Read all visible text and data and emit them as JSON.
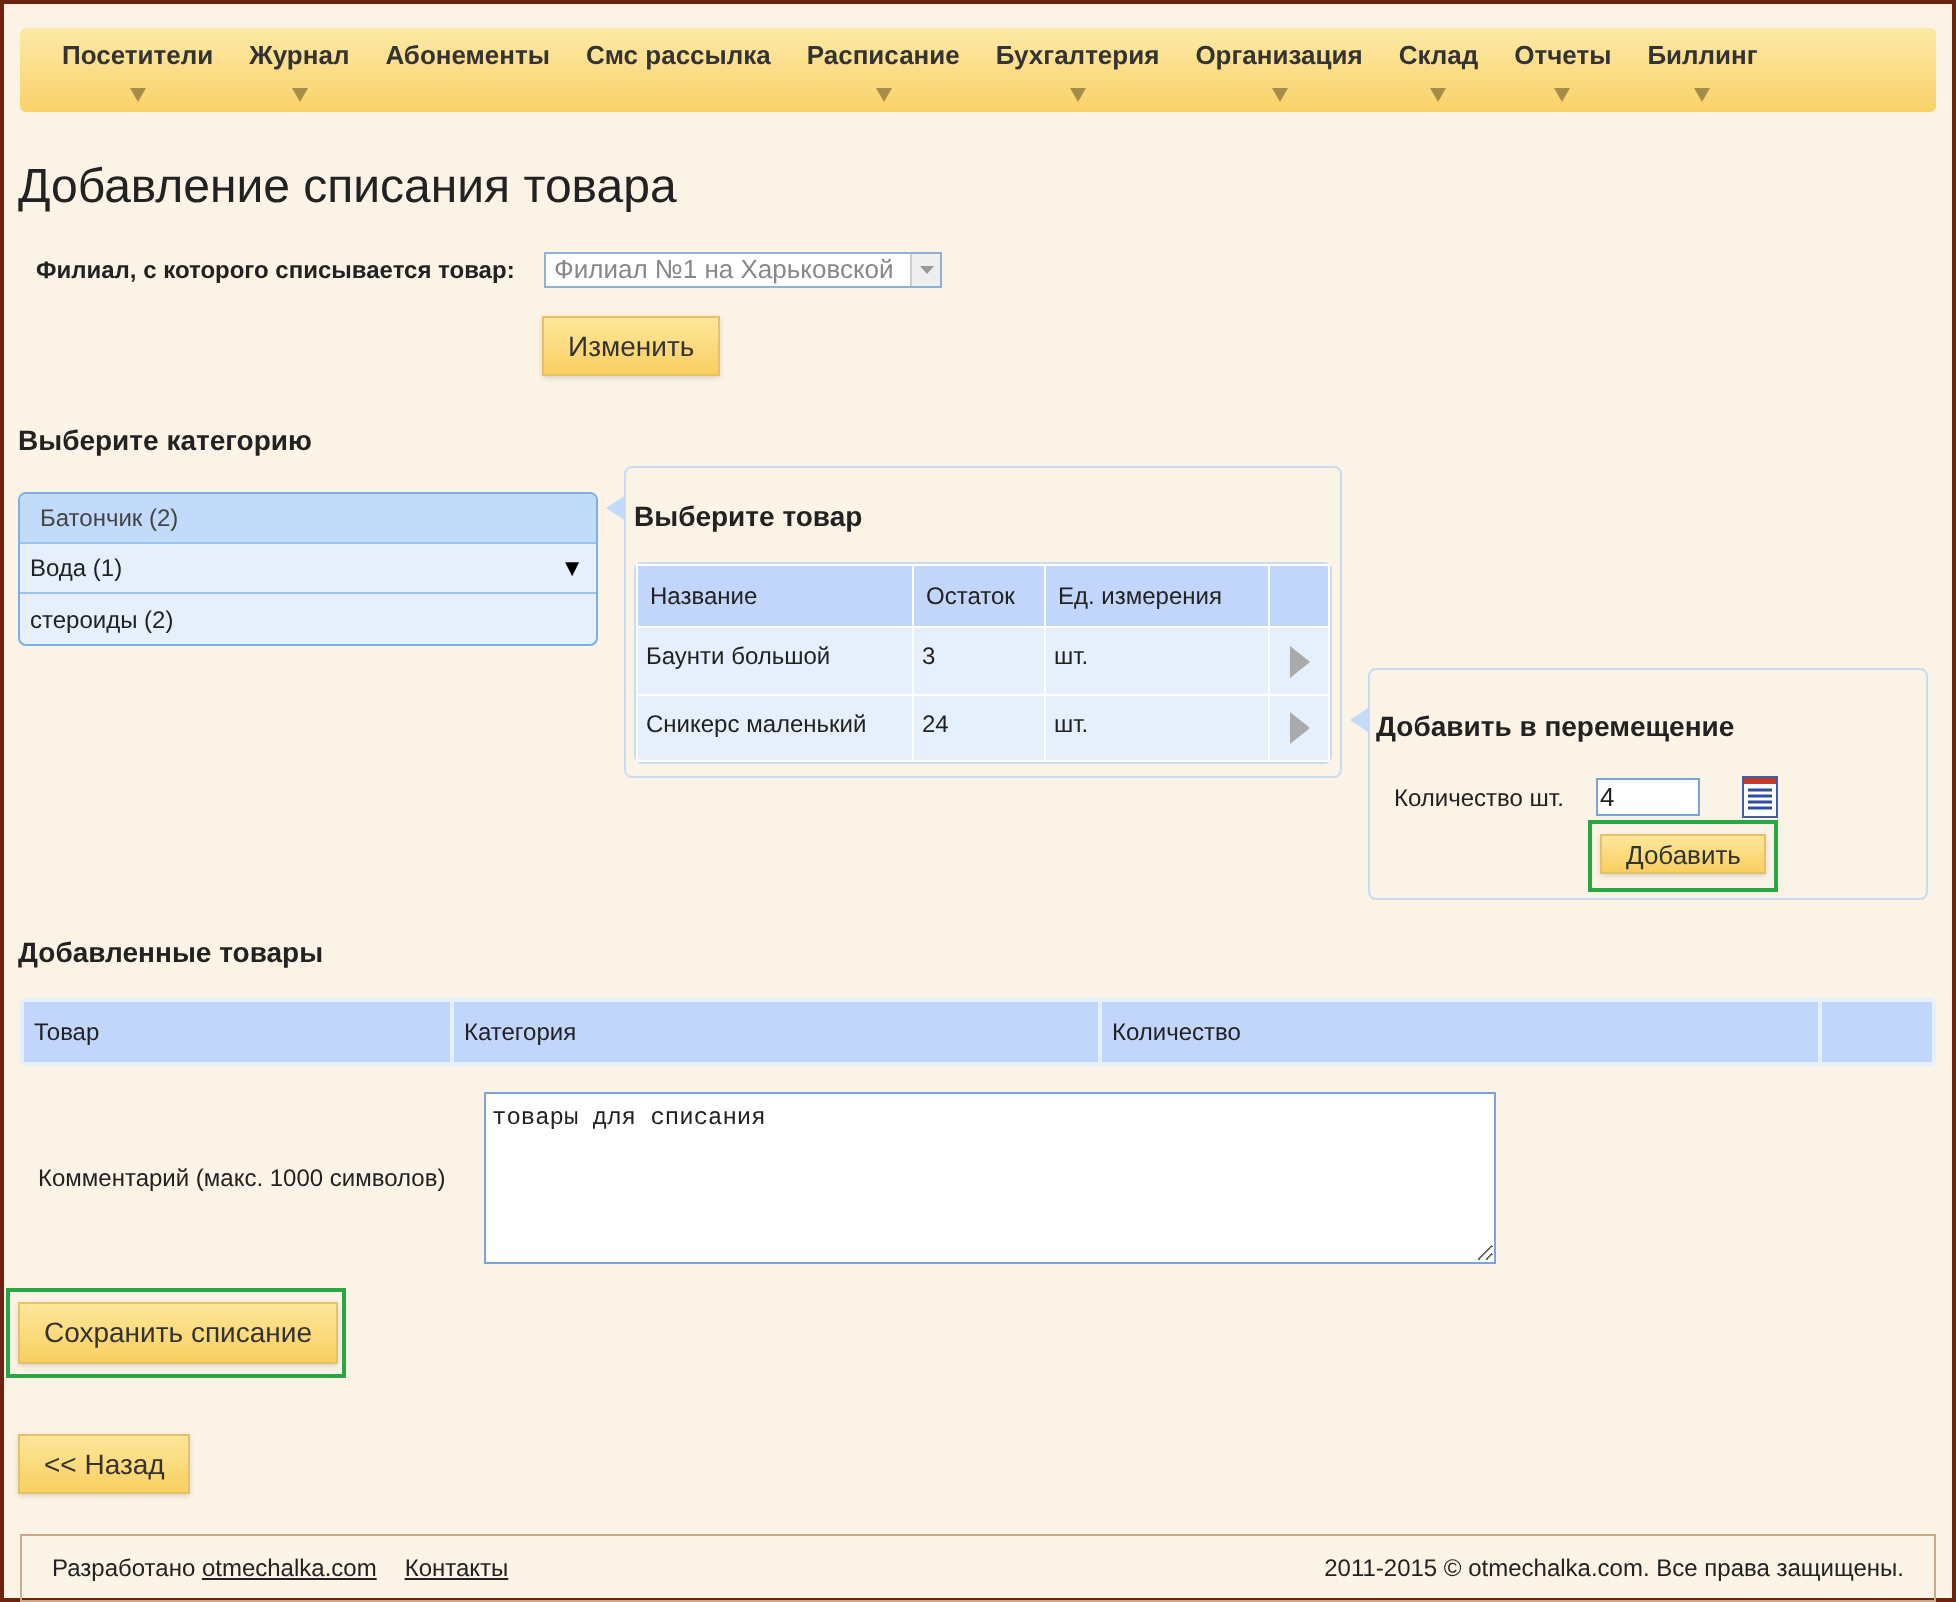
{
  "nav": [
    {
      "label": "Посетители",
      "has_menu": true
    },
    {
      "label": "Журнал",
      "has_menu": true
    },
    {
      "label": "Абонементы",
      "has_menu": false
    },
    {
      "label": "Смс рассылка",
      "has_menu": false
    },
    {
      "label": "Расписание",
      "has_menu": true
    },
    {
      "label": "Бухгалтерия",
      "has_menu": true
    },
    {
      "label": "Организация",
      "has_menu": true
    },
    {
      "label": "Склад",
      "has_menu": true
    },
    {
      "label": "Отчеты",
      "has_menu": true
    },
    {
      "label": "Биллинг",
      "has_menu": true
    }
  ],
  "title": "Добавление списания товара",
  "branch": {
    "label": "Филиал, с которого списывается товар:",
    "value": "Филиал №1 на Харьковской",
    "button": "Изменить"
  },
  "categories": {
    "heading": "Выберите категорию",
    "items": [
      {
        "label": "Батончик (2)",
        "selected": true
      },
      {
        "label": "Вода (1)",
        "selected": false,
        "expandable": true,
        "expander": "▼"
      },
      {
        "label": "стероиды (2)",
        "selected": false
      }
    ]
  },
  "products": {
    "heading": "Выберите товар",
    "columns": [
      "Название",
      "Остаток",
      "Ед. измерения"
    ],
    "rows": [
      {
        "name": "Баунти большой",
        "stock": "3",
        "unit": "шт."
      },
      {
        "name": "Сникерс маленький",
        "stock": "24",
        "unit": "шт."
      }
    ]
  },
  "add_panel": {
    "heading": "Добавить в перемещение",
    "quantity_label": "Количество шт.",
    "quantity": "4",
    "button": "Добавить",
    "highlighted": true
  },
  "added": {
    "heading": "Добавленные товары",
    "columns": [
      "Товар",
      "Категория",
      "Количество"
    ]
  },
  "comment": {
    "label": "Комментарий (макс. 1000 символов)",
    "value": "товары для списания"
  },
  "save_button": {
    "label": "Сохранить списание",
    "highlighted": true
  },
  "back_button": "<< Назад",
  "footer": {
    "developed": "Разработано",
    "site": "otmechalka.com",
    "contacts": "Контакты",
    "copyright": "2011-2015 © otmechalka.com. Все права защищены."
  }
}
